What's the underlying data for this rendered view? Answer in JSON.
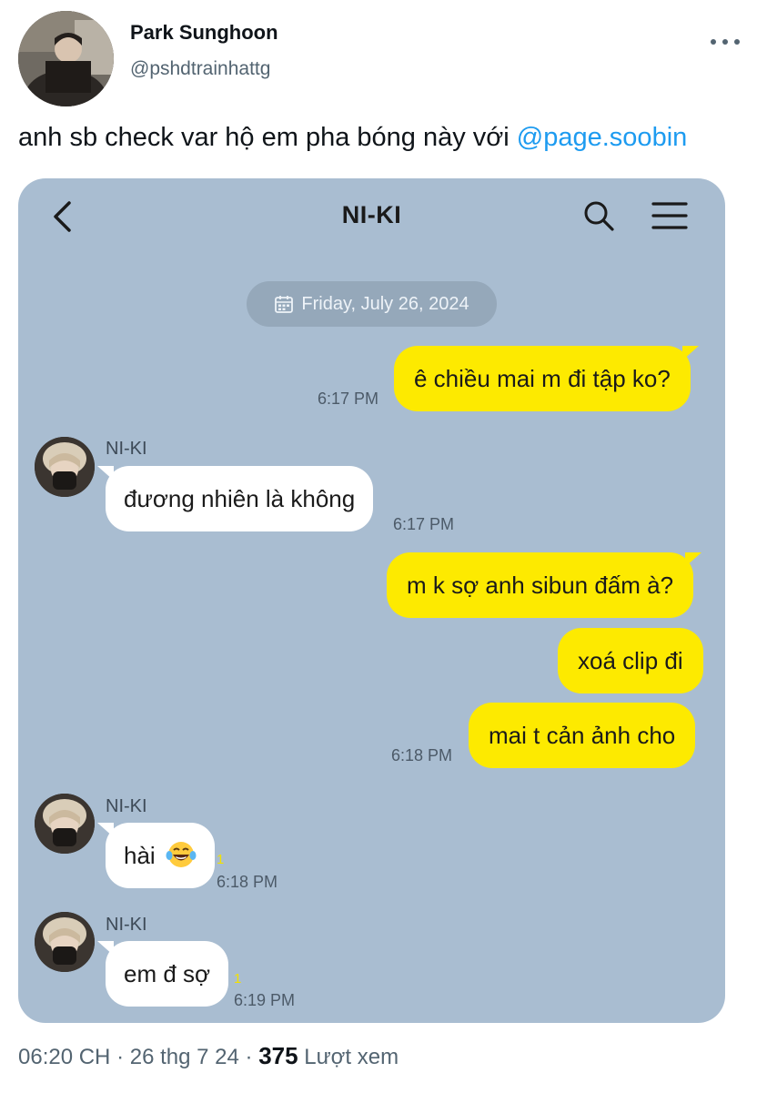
{
  "author": {
    "name": "Park Sunghoon",
    "handle": "@pshdtrainhattg"
  },
  "tweet": {
    "text": "anh sb check var hộ em pha bóng này với ",
    "mention": "@page.soobin"
  },
  "chat": {
    "title": "NI-KI",
    "date": "Friday, July 26, 2024",
    "messages": [
      {
        "from": "me",
        "text": "ê chiều mai m đi tập ko?",
        "time": "6:17 PM"
      },
      {
        "from": "peer",
        "sender": "NI-KI",
        "text": "đương nhiên là không",
        "time": "6:17 PM"
      },
      {
        "from": "me",
        "text": "m k sợ anh sibun đấm à?"
      },
      {
        "from": "me",
        "text": "xoá clip đi"
      },
      {
        "from": "me",
        "text": "mai t cản ảnh cho",
        "time": "6:18 PM"
      },
      {
        "from": "peer",
        "sender": "NI-KI",
        "text": "hài",
        "emoji": "laughing-tears-emoji",
        "unread": "1",
        "time": "6:18 PM"
      },
      {
        "from": "peer",
        "sender": "NI-KI",
        "text": "em đ sợ",
        "unread": "1",
        "time": "6:19 PM"
      }
    ]
  },
  "meta": {
    "time": "06:20 CH",
    "date": "26 thg 7 24",
    "separator": "·",
    "views": "375",
    "views_label": "Lượt xem"
  },
  "colors": {
    "chat_bg": "#a9bdd1",
    "my_bubble": "#fdea00",
    "peer_bubble": "#ffffff",
    "mention": "#1d9bf0"
  },
  "icons": [
    "more-icon",
    "back-icon",
    "search-icon",
    "menu-icon",
    "calendar-icon"
  ]
}
